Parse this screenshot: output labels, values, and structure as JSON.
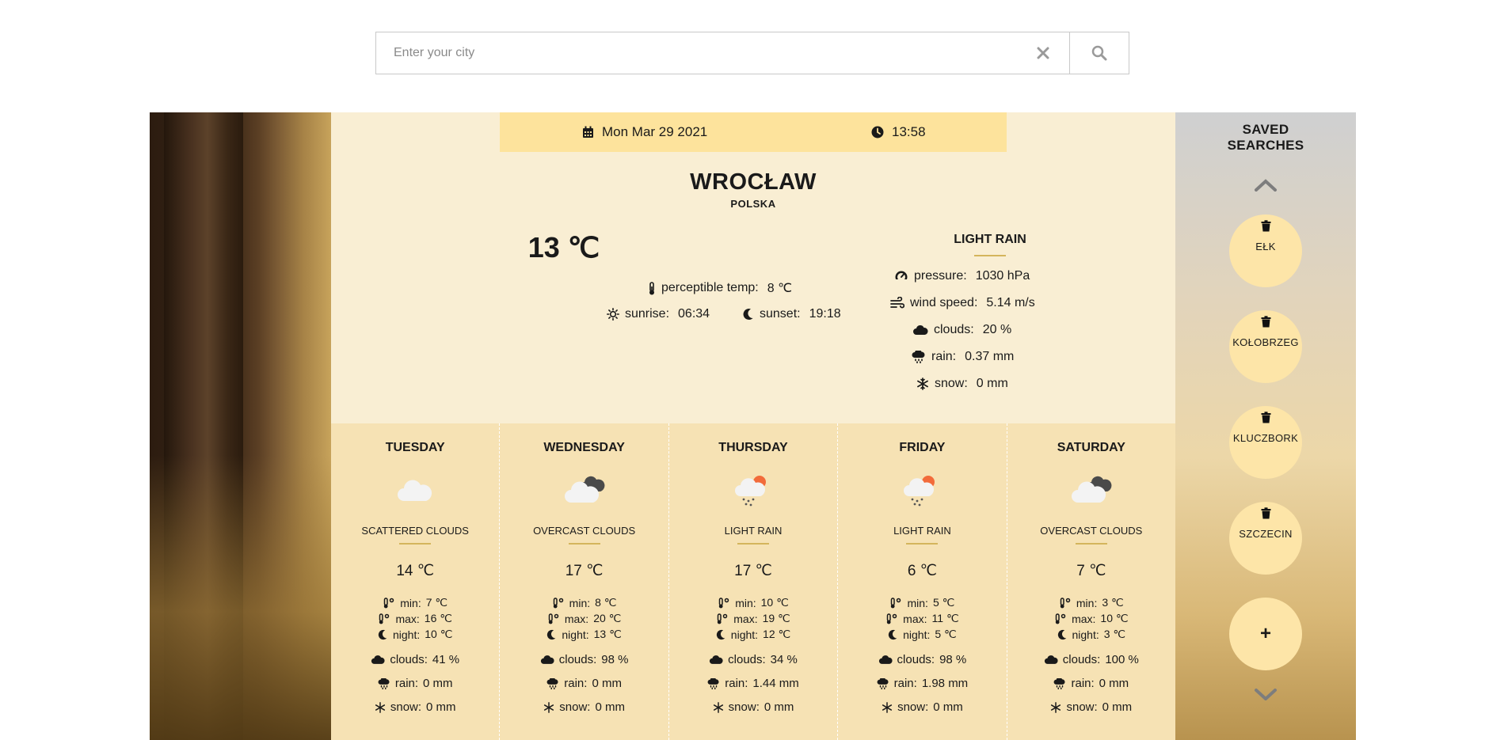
{
  "search": {
    "placeholder": "Enter your city",
    "value": ""
  },
  "current": {
    "date": "Mon Mar 29 2021",
    "time": "13:58",
    "city": "WROCŁAW",
    "country": "POLSKA",
    "temp": "13 ℃",
    "perceptible_label": "perceptible temp:",
    "perceptible_value": "8 ℃",
    "sunrise_label": "sunrise:",
    "sunrise_value": "06:34",
    "sunset_label": "sunset:",
    "sunset_value": "19:18",
    "description": "LIGHT RAIN",
    "pressure_label": "pressure:",
    "pressure_value": "1030 hPa",
    "wind_label": "wind speed:",
    "wind_value": "5.14 m/s",
    "clouds_label": "clouds:",
    "clouds_value": "20 %",
    "rain_label": "rain:",
    "rain_value": "0.37 mm",
    "snow_label": "snow:",
    "snow_value": "0 mm"
  },
  "labels": {
    "min": "min:",
    "max": "max:",
    "night": "night:",
    "clouds": "clouds:",
    "rain": "rain:",
    "snow": "snow:"
  },
  "forecast": [
    {
      "day": "TUESDAY",
      "icon": "cloud-icon",
      "desc": "SCATTERED CLOUDS",
      "temp": "14 ℃",
      "min": "7 ℃",
      "max": "16 ℃",
      "night": "10 ℃",
      "clouds": "41 %",
      "rain": "0 mm",
      "snow": "0 mm"
    },
    {
      "day": "WEDNESDAY",
      "icon": "overcast-clouds-icon",
      "desc": "OVERCAST CLOUDS",
      "temp": "17 ℃",
      "min": "8 ℃",
      "max": "20 ℃",
      "night": "13 ℃",
      "clouds": "98 %",
      "rain": "0 mm",
      "snow": "0 mm"
    },
    {
      "day": "THURSDAY",
      "icon": "light-rain-icon",
      "desc": "LIGHT RAIN",
      "temp": "17 ℃",
      "min": "10 ℃",
      "max": "19 ℃",
      "night": "12 ℃",
      "clouds": "34 %",
      "rain": "1.44 mm",
      "snow": "0 mm"
    },
    {
      "day": "FRIDAY",
      "icon": "light-rain-icon",
      "desc": "LIGHT RAIN",
      "temp": "6 ℃",
      "min": "5 ℃",
      "max": "11 ℃",
      "night": "5 ℃",
      "clouds": "98 %",
      "rain": "1.98 mm",
      "snow": "0 mm"
    },
    {
      "day": "SATURDAY",
      "icon": "overcast-clouds-icon",
      "desc": "OVERCAST CLOUDS",
      "temp": "7 ℃",
      "min": "3 ℃",
      "max": "10 ℃",
      "night": "3 ℃",
      "clouds": "100 %",
      "rain": "0 mm",
      "snow": "0 mm"
    }
  ],
  "saved": {
    "title_line1": "SAVED",
    "title_line2": "SEARCHES",
    "items": [
      "EŁK",
      "KOŁOBRZEG",
      "KLUCZBORK",
      "SZCZECIN"
    ],
    "add_label": "+"
  },
  "colors": {
    "accent_bar": "#fde39c",
    "current_bg": "#f9eed3",
    "forecast_bg": "#f6e2b4",
    "underline": "#d4b55c",
    "saved_item_bg": "#fde5a8"
  }
}
